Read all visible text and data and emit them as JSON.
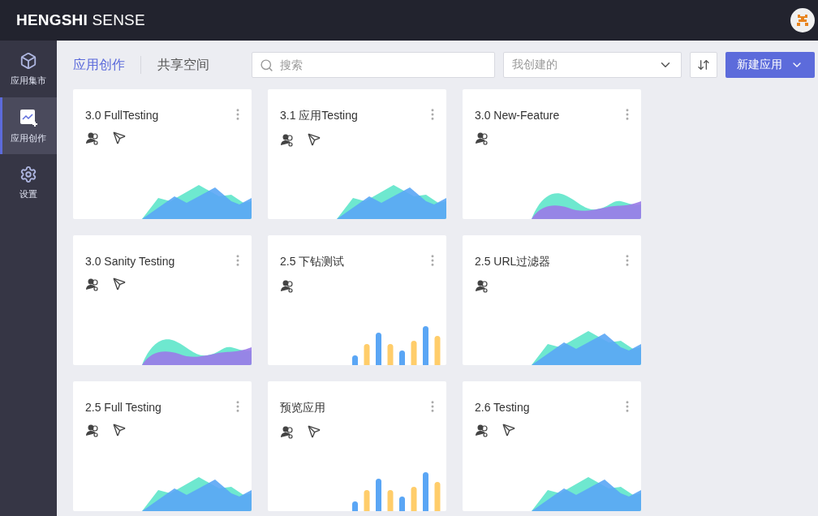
{
  "logo": "**HENGSHI** SENSE",
  "sidebar": {
    "items": [
      {
        "label": "应用集市",
        "kind": "cube",
        "selected": false
      },
      {
        "label": "应用创作",
        "kind": "chart",
        "selected": true
      },
      {
        "label": "设置",
        "kind": "gear",
        "selected": false
      }
    ]
  },
  "tabs": [
    {
      "label": "应用创作",
      "selected": true
    },
    {
      "label": "共享空间",
      "selected": false
    }
  ],
  "search": {
    "placeholder": "搜索"
  },
  "filter": {
    "value": "我创建的"
  },
  "new_button": {
    "label": "新建应用"
  },
  "apps": [
    {
      "title": "3.0 FullTesting",
      "published": true,
      "kind": "mountain"
    },
    {
      "title": "3.1 应用Testing",
      "published": true,
      "kind": "mountain"
    },
    {
      "title": "3.0 New-Feature",
      "published": false,
      "kind": "wave"
    },
    {
      "title": "3.0 Sanity Testing",
      "published": true,
      "kind": "wave"
    },
    {
      "title": "2.5 下钻测试",
      "published": false,
      "kind": "bars"
    },
    {
      "title": "2.5 URL过滤器",
      "published": false,
      "kind": "mountain"
    },
    {
      "title": "2.5 Full Testing",
      "published": true,
      "kind": "mountain"
    },
    {
      "title": "预览应用",
      "published": true,
      "kind": "bars"
    },
    {
      "title": "2.6 Testing",
      "published": true,
      "kind": "mountain"
    }
  ]
}
